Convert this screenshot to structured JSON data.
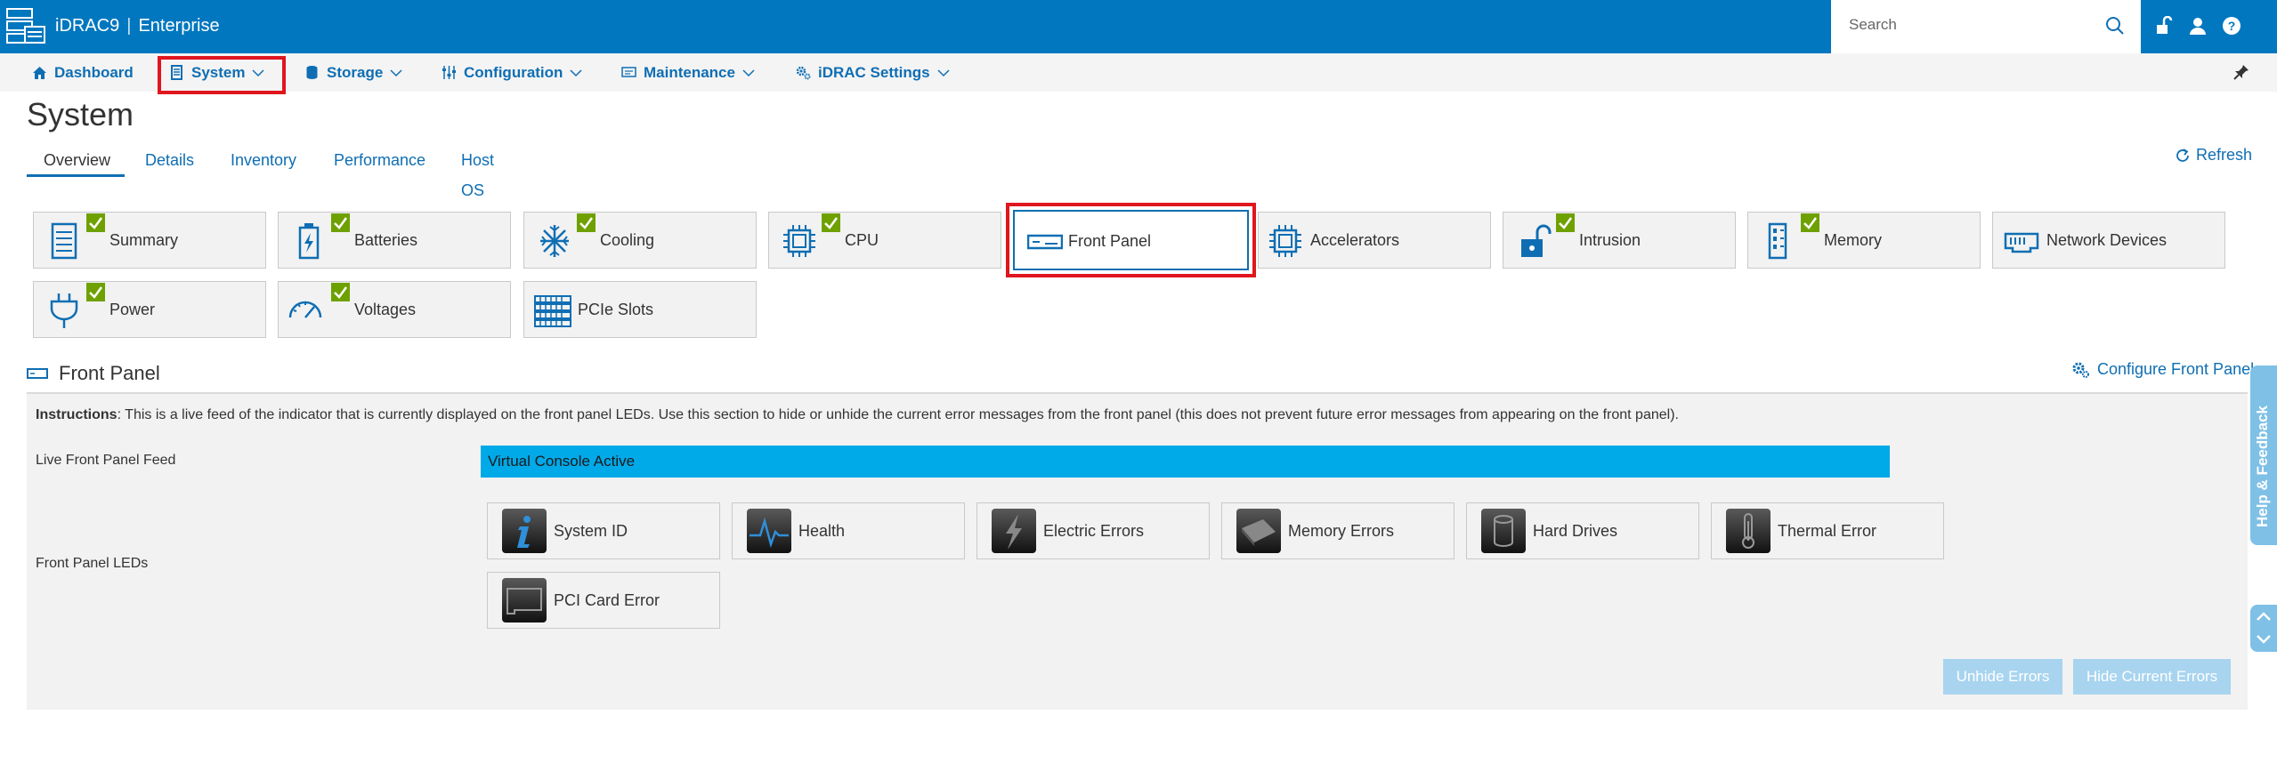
{
  "header": {
    "product": "iDRAC9",
    "edition": "Enterprise",
    "search_placeholder": "Search"
  },
  "nav": {
    "items": [
      {
        "label": "Dashboard"
      },
      {
        "label": "System"
      },
      {
        "label": "Storage"
      },
      {
        "label": "Configuration"
      },
      {
        "label": "Maintenance"
      },
      {
        "label": "iDRAC Settings"
      }
    ]
  },
  "page": {
    "title": "System",
    "tabs": [
      {
        "label": "Overview"
      },
      {
        "label": "Details"
      },
      {
        "label": "Inventory"
      },
      {
        "label": "Performance"
      },
      {
        "label": "Host OS"
      }
    ],
    "refresh_label": "Refresh"
  },
  "tiles": [
    {
      "label": "Summary",
      "icon": "summary-icon",
      "status": "ok"
    },
    {
      "label": "Batteries",
      "icon": "battery-icon",
      "status": "ok"
    },
    {
      "label": "Cooling",
      "icon": "snowflake-icon",
      "status": "ok"
    },
    {
      "label": "CPU",
      "icon": "cpu-icon",
      "status": "ok"
    },
    {
      "label": "Front Panel",
      "icon": "front-panel-icon",
      "status": "selected"
    },
    {
      "label": "Accelerators",
      "icon": "accelerator-icon",
      "status": "none"
    },
    {
      "label": "Intrusion",
      "icon": "lock-icon",
      "status": "ok"
    },
    {
      "label": "Memory",
      "icon": "memory-icon",
      "status": "ok"
    },
    {
      "label": "Network Devices",
      "icon": "network-icon",
      "status": "none"
    },
    {
      "label": "Power",
      "icon": "plug-icon",
      "status": "ok"
    },
    {
      "label": "Voltages",
      "icon": "gauge-icon",
      "status": "ok"
    },
    {
      "label": "PCIe Slots",
      "icon": "pcie-icon",
      "status": "none"
    }
  ],
  "front_panel": {
    "title": "Front Panel",
    "configure_label": "Configure Front Panel",
    "instructions_label": "Instructions",
    "instructions_text": ":  This is a live feed of the indicator that is currently displayed on the front panel LEDs. Use this section to hide or unhide the current error messages from the front panel (this does not prevent future error messages from appearing on the front panel).",
    "live_feed_label": "Live Front Panel Feed",
    "live_feed_value": "Virtual Console Active",
    "leds_label": "Front Panel LEDs",
    "leds": [
      {
        "label": "System ID",
        "icon": "info-icon"
      },
      {
        "label": "Health",
        "icon": "heartbeat-icon"
      },
      {
        "label": "Electric Errors",
        "icon": "lightning-icon"
      },
      {
        "label": "Memory Errors",
        "icon": "memory-chip-icon"
      },
      {
        "label": "Hard Drives",
        "icon": "hard-drive-icon"
      },
      {
        "label": "Thermal Error",
        "icon": "thermometer-icon"
      },
      {
        "label": "PCI Card Error",
        "icon": "pci-card-icon"
      }
    ],
    "unhide_label": "Unhide Errors",
    "hide_label": "Hide Current Errors"
  },
  "help_feedback_label": "Help & Feedback",
  "colors": {
    "brand": "#0077bf",
    "link": "#0f6eb3",
    "ok": "#6ea100",
    "highlight": "#e0161e",
    "feed": "#00a9e8"
  }
}
